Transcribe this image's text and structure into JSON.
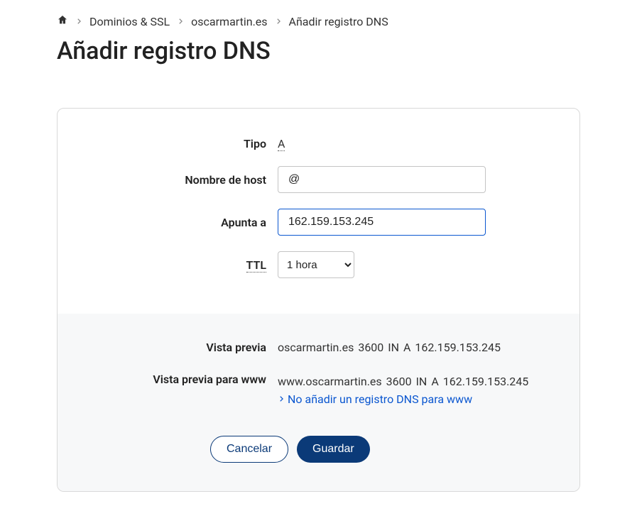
{
  "breadcrumb": {
    "home": "Inicio",
    "items": [
      {
        "label": "Dominios & SSL"
      },
      {
        "label": "oscarmartin.es"
      },
      {
        "label": "Añadir registro DNS"
      }
    ]
  },
  "page_title": "Añadir registro DNS",
  "form": {
    "type_label": "Tipo",
    "type_value": "A",
    "hostname_label": "Nombre de host",
    "hostname_value": "@",
    "points_to_label": "Apunta a",
    "points_to_value": "162.159.153.245",
    "ttl_label": "TTL",
    "ttl_value": "1 hora"
  },
  "preview": {
    "preview_label": "Vista previa",
    "preview_value": "oscarmartin.es  3600  IN  A  162.159.153.245",
    "preview_www_label": "Vista previa para www",
    "preview_www_value": "www.oscarmartin.es  3600  IN  A  162.159.153.245",
    "no_add_www_label": "No añadir un registro DNS para www"
  },
  "actions": {
    "cancel": "Cancelar",
    "save": "Guardar"
  }
}
